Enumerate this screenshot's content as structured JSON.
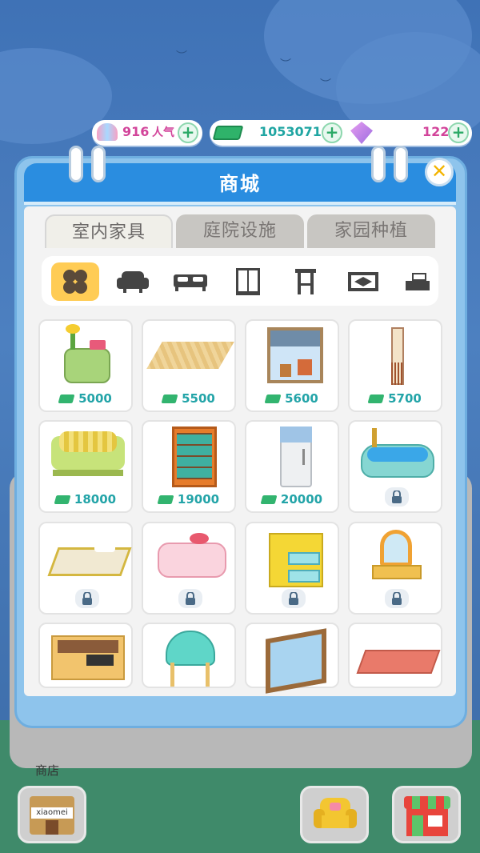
{
  "currency": {
    "popularity_value": "916",
    "popularity_unit": "人气",
    "cash_value": "1053071",
    "gems_value": "122"
  },
  "shop": {
    "title": "商城",
    "tabs": [
      {
        "label": "室内家具",
        "active": true
      },
      {
        "label": "庭院设施",
        "active": false
      },
      {
        "label": "家园种植",
        "active": false
      }
    ],
    "categories": [
      {
        "icon": "all-icon",
        "active": true
      },
      {
        "icon": "sofa-icon",
        "active": false
      },
      {
        "icon": "bed-icon",
        "active": false
      },
      {
        "icon": "wardrobe-icon",
        "active": false
      },
      {
        "icon": "stool-icon",
        "active": false
      },
      {
        "icon": "rug-icon",
        "active": false
      },
      {
        "icon": "cabinet-icon",
        "active": false
      }
    ],
    "items": [
      {
        "name": "nightstand-with-plant",
        "price": "5000",
        "locked": false
      },
      {
        "name": "straw-mat",
        "price": "5500",
        "locked": false
      },
      {
        "name": "window-with-blinds",
        "price": "5600",
        "locked": false
      },
      {
        "name": "door-curtain",
        "price": "5700",
        "locked": false
      },
      {
        "name": "striped-sofa",
        "price": "18000",
        "locked": false
      },
      {
        "name": "bookshelf-cabinet",
        "price": "19000",
        "locked": false
      },
      {
        "name": "refrigerator",
        "price": "20000",
        "locked": false
      },
      {
        "name": "bathtub",
        "price": "",
        "locked": true
      },
      {
        "name": "double-bed",
        "price": "",
        "locked": true
      },
      {
        "name": "pink-bed",
        "price": "",
        "locked": true
      },
      {
        "name": "yellow-drawer",
        "price": "",
        "locked": true
      },
      {
        "name": "vanity-mirror",
        "price": "",
        "locked": true
      },
      {
        "name": "writing-desk",
        "price": "",
        "locked": true
      },
      {
        "name": "teal-chair",
        "price": "",
        "locked": true
      },
      {
        "name": "wooden-window",
        "price": "",
        "locked": true
      },
      {
        "name": "coral-sofa",
        "price": "",
        "locked": true
      }
    ]
  },
  "bottom": {
    "store_label": "商店",
    "store_sign": "xiaomei"
  },
  "colors": {
    "header_blue": "#2a8de0",
    "price_teal": "#23a4a8",
    "popularity_pink": "#d2449a",
    "active_category": "#ffcc55"
  }
}
